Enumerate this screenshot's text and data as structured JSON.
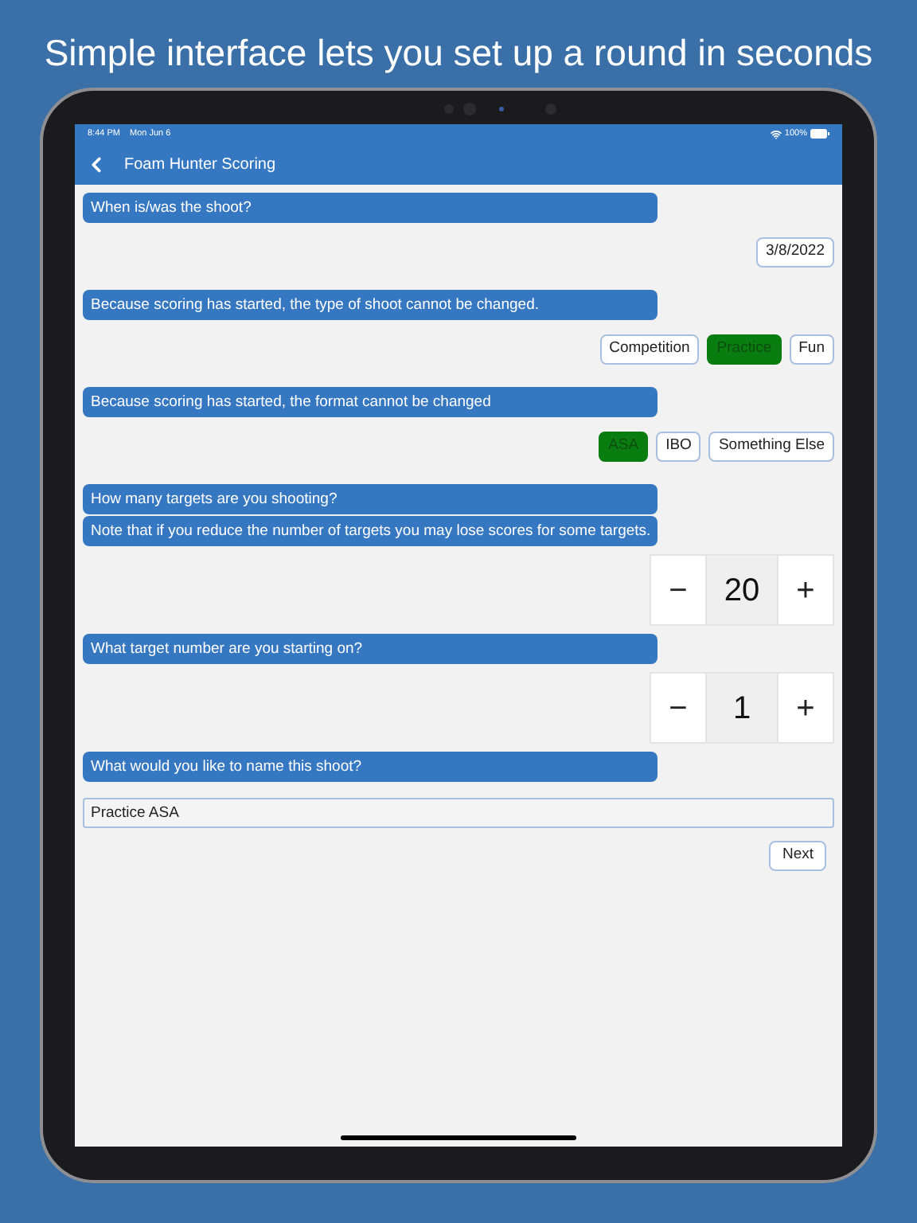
{
  "headline": "Simple interface lets you set up a round in seconds",
  "status_bar": {
    "time": "8:44 PM",
    "date": "Mon Jun 6",
    "battery": "100%"
  },
  "nav": {
    "title": "Foam Hunter Scoring"
  },
  "sections": [
    {
      "kind": "date",
      "prompts": [
        "When is/was the shoot?"
      ],
      "value": "3/8/2022"
    },
    {
      "kind": "choices",
      "prompts": [
        "Because scoring has started, the type of shoot cannot be changed."
      ],
      "options": [
        {
          "label": "Competition",
          "selected": false
        },
        {
          "label": "Practice",
          "selected": true
        },
        {
          "label": "Fun",
          "selected": false
        }
      ]
    },
    {
      "kind": "choices",
      "prompts": [
        "Because scoring has started, the format cannot be changed"
      ],
      "options": [
        {
          "label": "ASA",
          "selected": true
        },
        {
          "label": "IBO",
          "selected": false
        },
        {
          "label": "Something Else",
          "selected": false
        }
      ]
    },
    {
      "kind": "stepper",
      "prompts": [
        "How many targets are you shooting?",
        "Note that if you reduce the number of targets you may lose scores for some targets."
      ],
      "decrement": "−",
      "value": "20",
      "increment": "+"
    },
    {
      "kind": "stepper",
      "prompts": [
        "What target number are you starting on?"
      ],
      "decrement": "−",
      "value": "1",
      "increment": "+"
    },
    {
      "kind": "text",
      "prompts": [
        "What would you like to name this shoot?"
      ],
      "value": "Practice ASA"
    }
  ],
  "next_button": "Next"
}
